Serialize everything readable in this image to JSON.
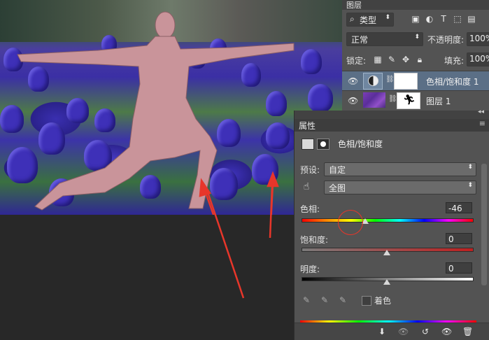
{
  "layers_panel": {
    "tab": "图层",
    "filter_kind": "类型",
    "blend_mode": "正常",
    "opacity_label": "不透明度:",
    "opacity_value": "100%",
    "lock_label": "锁定:",
    "fill_label": "填充:",
    "fill_value": "100%",
    "layers": [
      {
        "name": "色相/饱和度 1",
        "type": "adjustment",
        "visible": true,
        "selected": true
      },
      {
        "name": "图层 1",
        "type": "pixel",
        "visible": true,
        "selected": false
      }
    ]
  },
  "properties_panel": {
    "tab": "属性",
    "title": "色相/饱和度",
    "preset_label": "预设:",
    "preset_value": "自定",
    "channel_value": "全图",
    "hue_label": "色相:",
    "hue_value": "-46",
    "saturation_label": "饱和度:",
    "saturation_value": "0",
    "lightness_label": "明度:",
    "lightness_value": "0",
    "colorize_label": "着色",
    "colorize_checked": false,
    "slider_levels": {
      "hue": -46,
      "hue_range": [
        -180,
        180
      ],
      "saturation": 0,
      "saturation_range": [
        -100,
        100
      ],
      "lightness": 0,
      "lightness_range": [
        -100,
        100
      ]
    }
  },
  "colors": {
    "annotation_arrow": "#e8362a",
    "panel_bg": "#535353",
    "selected_layer": "#5b6f86"
  }
}
